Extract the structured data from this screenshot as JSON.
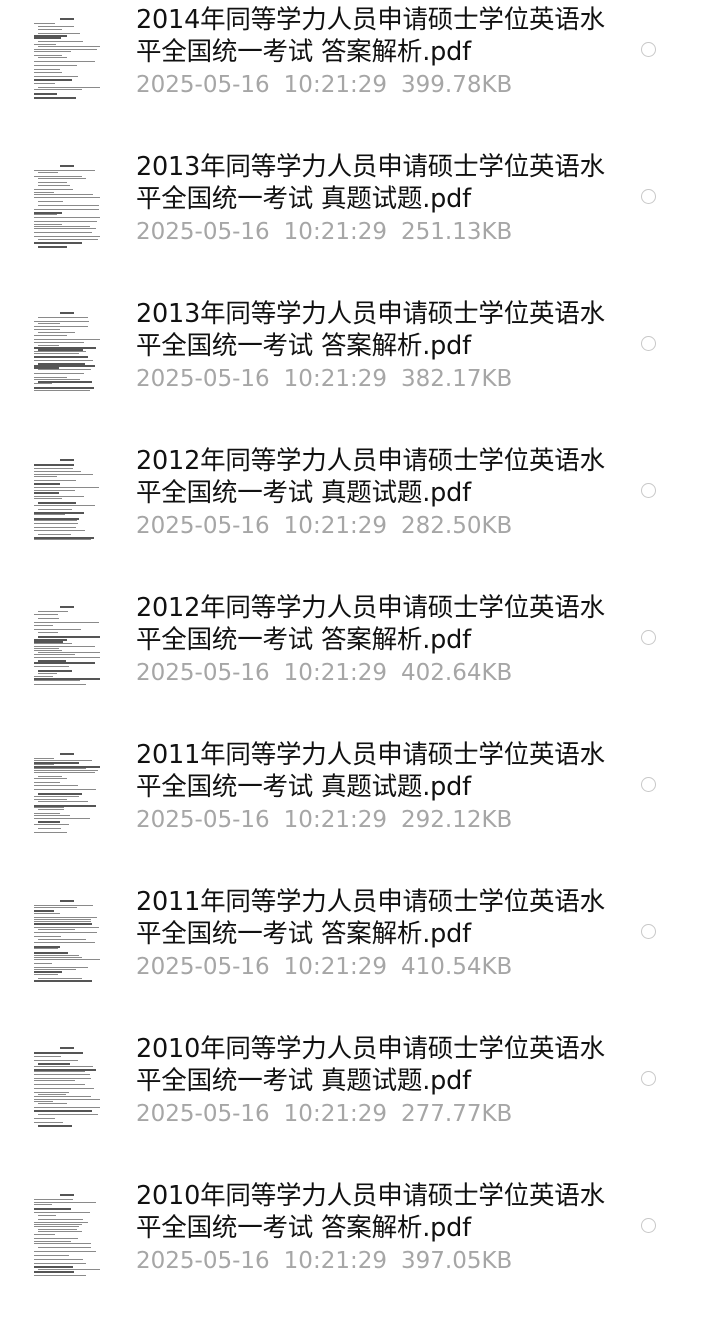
{
  "files": [
    {
      "name": "2014年同等学力人员申请硕士学位英语水平全国统一考试  答案解析.pdf",
      "date": "2025-05-16",
      "time": "10:21:29",
      "size": "399.78KB",
      "thumbnail_icon": "pdf-page-thumbnail"
    },
    {
      "name": "2013年同等学力人员申请硕士学位英语水平全国统一考试  真题试题.pdf",
      "date": "2025-05-16",
      "time": "10:21:29",
      "size": "251.13KB",
      "thumbnail_icon": "pdf-page-thumbnail"
    },
    {
      "name": "2013年同等学力人员申请硕士学位英语水平全国统一考试  答案解析.pdf",
      "date": "2025-05-16",
      "time": "10:21:29",
      "size": "382.17KB",
      "thumbnail_icon": "pdf-page-thumbnail"
    },
    {
      "name": "2012年同等学力人员申请硕士学位英语水平全国统一考试  真题试题.pdf",
      "date": "2025-05-16",
      "time": "10:21:29",
      "size": "282.50KB",
      "thumbnail_icon": "pdf-page-thumbnail"
    },
    {
      "name": "2012年同等学力人员申请硕士学位英语水平全国统一考试  答案解析.pdf",
      "date": "2025-05-16",
      "time": "10:21:29",
      "size": "402.64KB",
      "thumbnail_icon": "pdf-page-thumbnail"
    },
    {
      "name": "2011年同等学力人员申请硕士学位英语水平全国统一考试  真题试题.pdf",
      "date": "2025-05-16",
      "time": "10:21:29",
      "size": "292.12KB",
      "thumbnail_icon": "pdf-page-thumbnail"
    },
    {
      "name": "2011年同等学力人员申请硕士学位英语水平全国统一考试  答案解析.pdf",
      "date": "2025-05-16",
      "time": "10:21:29",
      "size": "410.54KB",
      "thumbnail_icon": "pdf-page-thumbnail"
    },
    {
      "name": "2010年同等学力人员申请硕士学位英语水平全国统一考试  真题试题.pdf",
      "date": "2025-05-16",
      "time": "10:21:29",
      "size": "277.77KB",
      "thumbnail_icon": "pdf-page-thumbnail"
    },
    {
      "name": "2010年同等学力人员申请硕士学位英语水平全国统一考试  答案解析.pdf",
      "date": "2025-05-16",
      "time": "10:21:29",
      "size": "397.05KB",
      "thumbnail_icon": "pdf-page-thumbnail"
    }
  ],
  "colors": {
    "name_text": "#111111",
    "meta_text": "#a6a6a6",
    "radio_border": "#c8c8c8",
    "background": "#ffffff"
  }
}
